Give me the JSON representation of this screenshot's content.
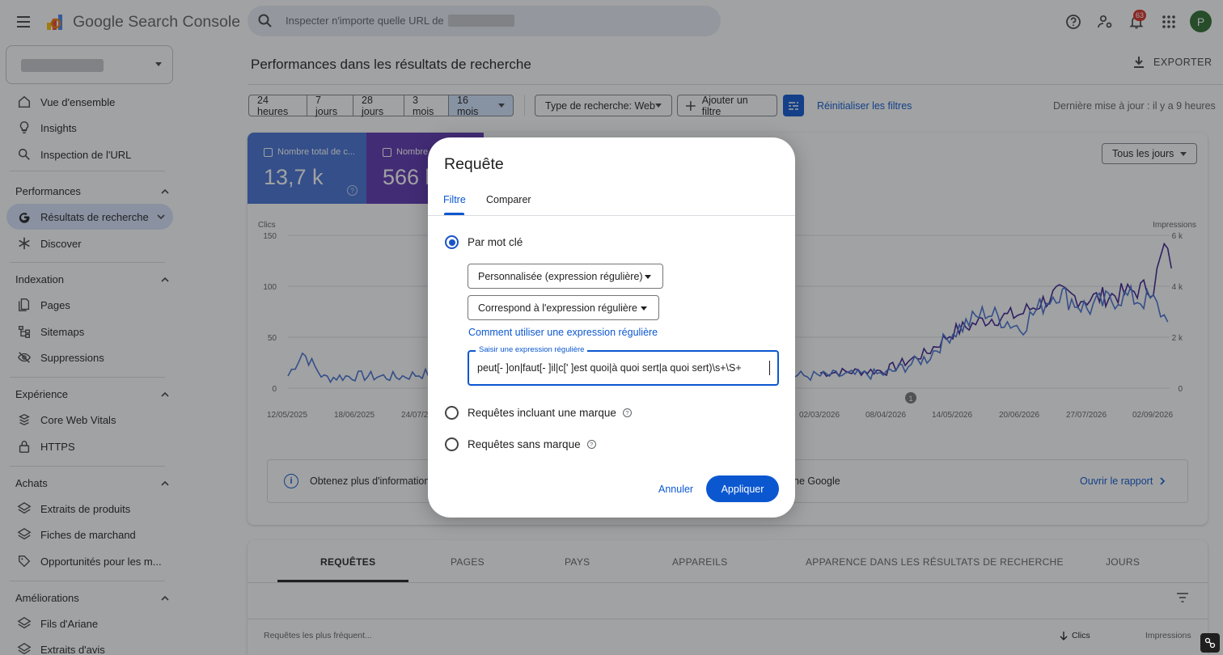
{
  "app": {
    "name": "Google Search Console",
    "notif_count": "63",
    "avatar_letter": "P"
  },
  "search": {
    "placeholder": "Inspecter n'importe quelle URL de"
  },
  "sidebar": {
    "top_items": [
      {
        "label": "Vue d'ensemble",
        "icon": "home-icon"
      },
      {
        "label": "Insights",
        "icon": "lightbulb-icon"
      },
      {
        "label": "Inspection de l'URL",
        "icon": "search-icon"
      }
    ],
    "sections": [
      {
        "title": "Performances",
        "items": [
          {
            "label": "Résultats de recherche",
            "icon": "google-g-icon"
          },
          {
            "label": "Discover",
            "icon": "asterisk-icon"
          }
        ]
      },
      {
        "title": "Indexation",
        "items": [
          {
            "label": "Pages",
            "icon": "pages-icon"
          },
          {
            "label": "Sitemaps",
            "icon": "sitemap-icon"
          },
          {
            "label": "Suppressions",
            "icon": "eye-off-icon"
          }
        ]
      },
      {
        "title": "Expérience",
        "items": [
          {
            "label": "Core Web Vitals",
            "icon": "gauge-icon"
          },
          {
            "label": "HTTPS",
            "icon": "lock-icon"
          }
        ]
      },
      {
        "title": "Achats",
        "items": [
          {
            "label": "Extraits de produits",
            "icon": "layers-icon"
          },
          {
            "label": "Fiches de marchand",
            "icon": "layers-icon"
          },
          {
            "label": "Opportunités pour les m...",
            "icon": "tag-icon"
          }
        ]
      },
      {
        "title": "Améliorations",
        "items": [
          {
            "label": "Fils d'Ariane",
            "icon": "layers-icon"
          },
          {
            "label": "Extraits d'avis",
            "icon": "layers-icon"
          }
        ]
      }
    ]
  },
  "main": {
    "title": "Performances dans les résultats de recherche",
    "export": "EXPORTER",
    "date_chips": [
      "24 heures",
      "7 jours",
      "28 jours",
      "3 mois",
      "16 mois"
    ],
    "search_type": "Type de recherche: Web",
    "add_filter": "Ajouter un filtre",
    "reset": "Réinitialiser les filtres",
    "last_update": "Dernière mise à jour : il y a 9 heures",
    "cards": [
      {
        "label": "Nombre total de c...",
        "value": "13,7 k"
      },
      {
        "label": "Nombre",
        "value": "566 k"
      }
    ],
    "granularity": "Tous les jours",
    "chart_left_title": "Clics",
    "chart_right_title": "Impressions",
    "y_left_ticks": [
      "150",
      "100",
      "50",
      "0"
    ],
    "y_right_ticks": [
      "6 k",
      "4 k",
      "2 k",
      "0"
    ],
    "x_ticks": [
      "12/05/2025",
      "18/06/2025",
      "24/07/2",
      "02/03/2026",
      "08/04/2026",
      "14/05/2026",
      "20/06/2026",
      "27/07/2026",
      "02/09/2026"
    ],
    "annotation_marker": "1",
    "info_text_left": "Obtenez plus d'informations",
    "info_text_right": "ne Google",
    "open_report": "Ouvrir le rapport",
    "tabs": [
      "REQUÊTES",
      "PAGES",
      "PAYS",
      "APPAREILS",
      "APPARENCE DANS LES RÉSULTATS DE RECHERCHE",
      "JOURS"
    ],
    "table_header": {
      "col1": "Requêtes les plus fréquent...",
      "col2": "Clics",
      "col3": "Impressions"
    }
  },
  "dialog": {
    "title": "Requête",
    "tabs": [
      "Filtre",
      "Comparer"
    ],
    "option_keyword": "Par mot clé",
    "match_type": "Personnalisée (expression régulière)",
    "operator": "Correspond à l'expression régulière",
    "help_link": "Comment utiliser une expression régulière",
    "input_label": "Saisir une expression régulière",
    "input_value": "peut[- ]on|faut[- ]il|c[' ]est quoi|à quoi sert|a quoi sert)\\s+\\S+",
    "option_brand": "Requêtes incluant une marque",
    "option_nobrand": "Requêtes sans marque",
    "cancel": "Annuler",
    "apply": "Appliquer"
  },
  "chart_data": {
    "type": "line",
    "xlabel": "",
    "ylabel_left": "Clics",
    "ylabel_right": "Impressions",
    "ylim_left": [
      0,
      150
    ],
    "ylim_right": [
      0,
      6000
    ],
    "x_range": [
      "12/05/2025",
      "02/09/2026"
    ],
    "x_ticks": [
      "12/05/2025",
      "18/06/2025",
      "24/07/2025",
      "02/03/2026",
      "08/04/2026",
      "14/05/2026",
      "20/06/2026",
      "27/07/2026",
      "02/09/2026"
    ],
    "series": [
      {
        "name": "Clics",
        "color": "#4470d4",
        "axis": "left",
        "x": [
          "12/05/2025",
          "20/05/2025",
          "01/06/2025",
          "18/06/2025",
          "10/07/2025",
          "24/07/2025",
          "02/03/2026",
          "08/04/2026",
          "30/04/2026",
          "14/05/2026",
          "01/06/2026",
          "20/06/2026",
          "10/07/2026",
          "27/07/2026",
          "15/08/2026",
          "02/09/2026",
          "10/09/2026"
        ],
        "values": [
          12,
          35,
          10,
          12,
          11,
          14,
          12,
          14,
          30,
          55,
          75,
          60,
          95,
          78,
          90,
          85,
          65
        ]
      },
      {
        "name": "Impressions",
        "color": "#3b1f8f",
        "axis": "right",
        "x": [
          "02/03/2026",
          "08/04/2026",
          "30/04/2026",
          "14/05/2026",
          "01/06/2026",
          "20/06/2026",
          "10/07/2026",
          "27/07/2026",
          "15/08/2026",
          "02/09/2026",
          "08/09/2026",
          "12/09/2026"
        ],
        "values": [
          600,
          700,
          1400,
          2200,
          2700,
          2900,
          3700,
          3500,
          3700,
          4000,
          5500,
          4700
        ]
      }
    ]
  },
  "colors": {
    "accent": "#0b57d0",
    "clicks": "#4470d4",
    "impressions": "#5e35b1",
    "active_nav": "#d7e2fb"
  }
}
